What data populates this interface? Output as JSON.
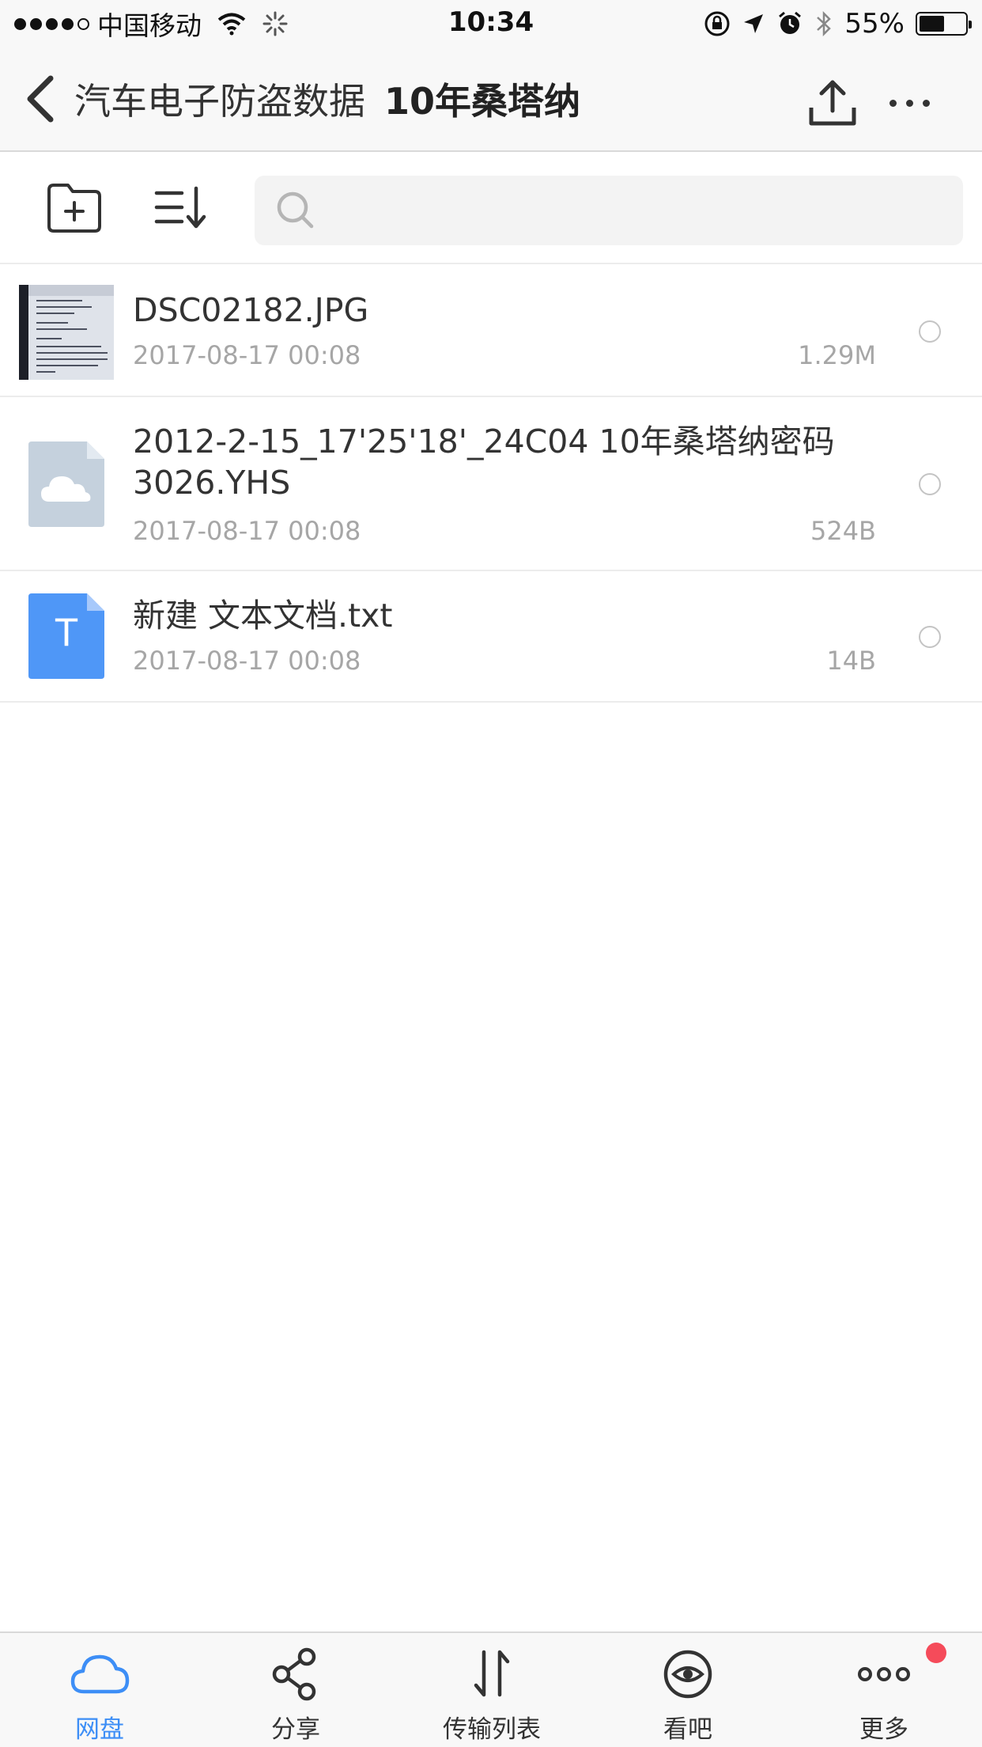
{
  "status_bar": {
    "carrier": "中国移动",
    "time": "10:34",
    "battery_percent": "55%",
    "battery_level": 0.55,
    "icons": [
      "signal-dots",
      "wifi-icon",
      "activity-spinner-icon",
      "orientation-lock-icon",
      "location-arrow-icon",
      "alarm-icon",
      "bluetooth-icon",
      "battery-icon"
    ]
  },
  "nav": {
    "parent_folder": "汽车电子防盗数据",
    "current_folder": "10年桑塔纳",
    "icons": [
      "back-chevron-icon",
      "upload-icon",
      "more-dots-icon"
    ]
  },
  "toolbar": {
    "search_placeholder": "",
    "icons": [
      "new-folder-icon",
      "sort-icon",
      "search-icon"
    ]
  },
  "files": [
    {
      "name": "DSC02182.JPG",
      "date": "2017-08-17 00:08",
      "size": "1.29M",
      "type_icon": "photo-thumbnail"
    },
    {
      "name": "2012-2-15_17'25'18'_24C04  10年桑塔纳密码3026.YHS",
      "date": "2017-08-17 00:08",
      "size": "524B",
      "type_icon": "cloud-file-icon"
    },
    {
      "name": "新建 文本文档.txt",
      "date": "2017-08-17 00:08",
      "size": "14B",
      "type_icon": "text-file-icon",
      "icon_letter": "T"
    }
  ],
  "tabs": [
    {
      "label": "网盘",
      "icon": "cloud-icon",
      "active": true
    },
    {
      "label": "分享",
      "icon": "share-icon",
      "active": false
    },
    {
      "label": "传输列表",
      "icon": "transfer-icon",
      "active": false
    },
    {
      "label": "看吧",
      "icon": "eye-icon",
      "active": false
    },
    {
      "label": "更多",
      "icon": "more-circles-icon",
      "active": false,
      "badge": true
    }
  ],
  "colors": {
    "accent": "#3d8ef6",
    "text_primary": "#333333",
    "text_secondary": "#a6a6a6",
    "badge": "#f54b5a",
    "bar_background": "#f8f8f8"
  }
}
